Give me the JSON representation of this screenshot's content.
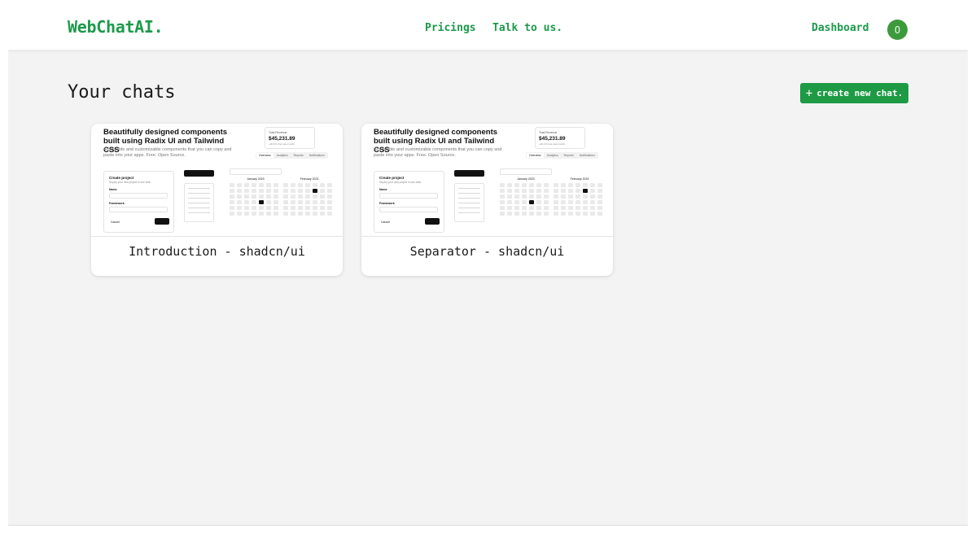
{
  "header": {
    "logo": "WebChatAI.",
    "nav": [
      {
        "label": "Pricings"
      },
      {
        "label": "Talk to us."
      }
    ],
    "dashboard_label": "Dashboard",
    "avatar_initial": "O"
  },
  "main": {
    "title": "Your chats",
    "new_chat_label": "create new chat.",
    "new_chat_icon": "plus-icon"
  },
  "chats": [
    {
      "title": "Introduction - shadcn/ui",
      "preview": {
        "heading": "Beautifully designed components built using Radix UI and Tailwind CSS",
        "subheading": "Accessible and customizable components that you can copy and paste into your apps. Free. Open Source.",
        "revenue_label": "Total Revenue",
        "revenue_value": "$45,231.89",
        "revenue_change": "+20.1% from last month",
        "tabs": [
          "Overview",
          "Analytics",
          "Reports",
          "Notifications"
        ],
        "form_title": "Create project",
        "form_description": "Deploy your new project in one-click.",
        "form_name_label": "Name",
        "form_framework_label": "Framework",
        "form_cancel": "Cancel",
        "calendar_months": [
          "January 2023",
          "February 2023"
        ]
      }
    },
    {
      "title": "Separator - shadcn/ui",
      "preview": {
        "heading": "Beautifully designed components built using Radix UI and Tailwind CSS",
        "subheading": "Accessible and customizable components that you can copy and paste into your apps. Free. Open Source.",
        "revenue_label": "Total Revenue",
        "revenue_value": "$45,231.89",
        "revenue_change": "+20.1% from last month",
        "tabs": [
          "Overview",
          "Analytics",
          "Reports",
          "Notifications"
        ],
        "form_title": "Create project",
        "form_description": "Deploy your new project in one-click.",
        "form_name_label": "Name",
        "form_framework_label": "Framework",
        "form_cancel": "Cancel",
        "calendar_months": [
          "January 2023",
          "February 2023"
        ]
      }
    }
  ],
  "colors": {
    "brand": "#1c9a4a",
    "button": "#1e9a45",
    "avatar": "#3c9a3c",
    "background": "#f3f3f3"
  }
}
